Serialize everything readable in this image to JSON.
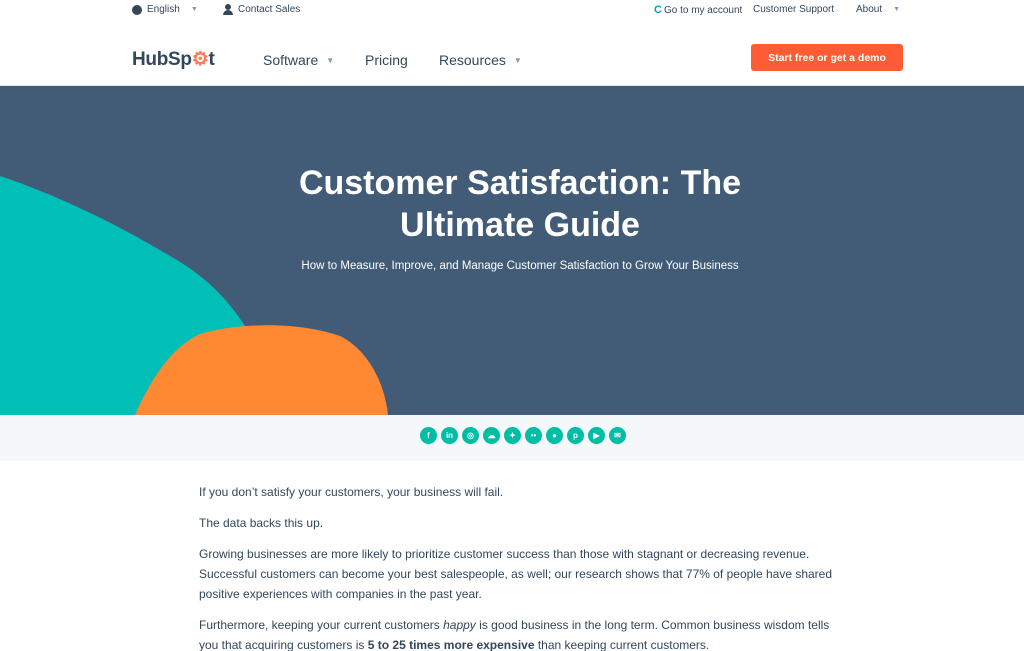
{
  "utility_bar": {
    "language": "English",
    "contact": "Contact Sales",
    "account": "Go to my account",
    "support": "Customer Support",
    "about": "About"
  },
  "nav": {
    "logo_hub": "HubSp",
    "logo_t": "t",
    "links": [
      "Software",
      "Pricing",
      "Resources"
    ],
    "cta": "Start free or get a demo"
  },
  "hero": {
    "title": "Customer Satisfaction: The Ultimate Guide",
    "subtitle": "How to Measure, Improve, and Manage Customer Satisfaction to Grow Your Business"
  },
  "social_icons": [
    "facebook-icon",
    "linkedin-icon",
    "instagram-icon",
    "soundcloud-icon",
    "twitter-icon",
    "flickr-icon",
    "github-icon",
    "pinterest-icon",
    "youtube-icon",
    "email-icon"
  ],
  "article": {
    "p1": "If you don’t satisfy your customers, your business will fail.",
    "p2": "The data backs this up.",
    "p3": "Growing businesses are more likely to prioritize customer success than those with stagnant or decreasing revenue. Successful customers can become your best salespeople, as well; our research shows that 77% of people have shared positive experiences with companies in the past year.",
    "p4_a": "Furthermore, keeping your current customers ",
    "p4_em": "happy",
    "p4_b": " is good business in the long term. Common business wisdom tells you that acquiring customers is ",
    "p4_strong": "5 to 25 times more expensive",
    "p4_c": " than keeping current customers."
  },
  "colors": {
    "brand_orange": "#ff5c35",
    "hero_bg": "#425b76",
    "teal": "#00bda5",
    "text": "#33475b"
  }
}
